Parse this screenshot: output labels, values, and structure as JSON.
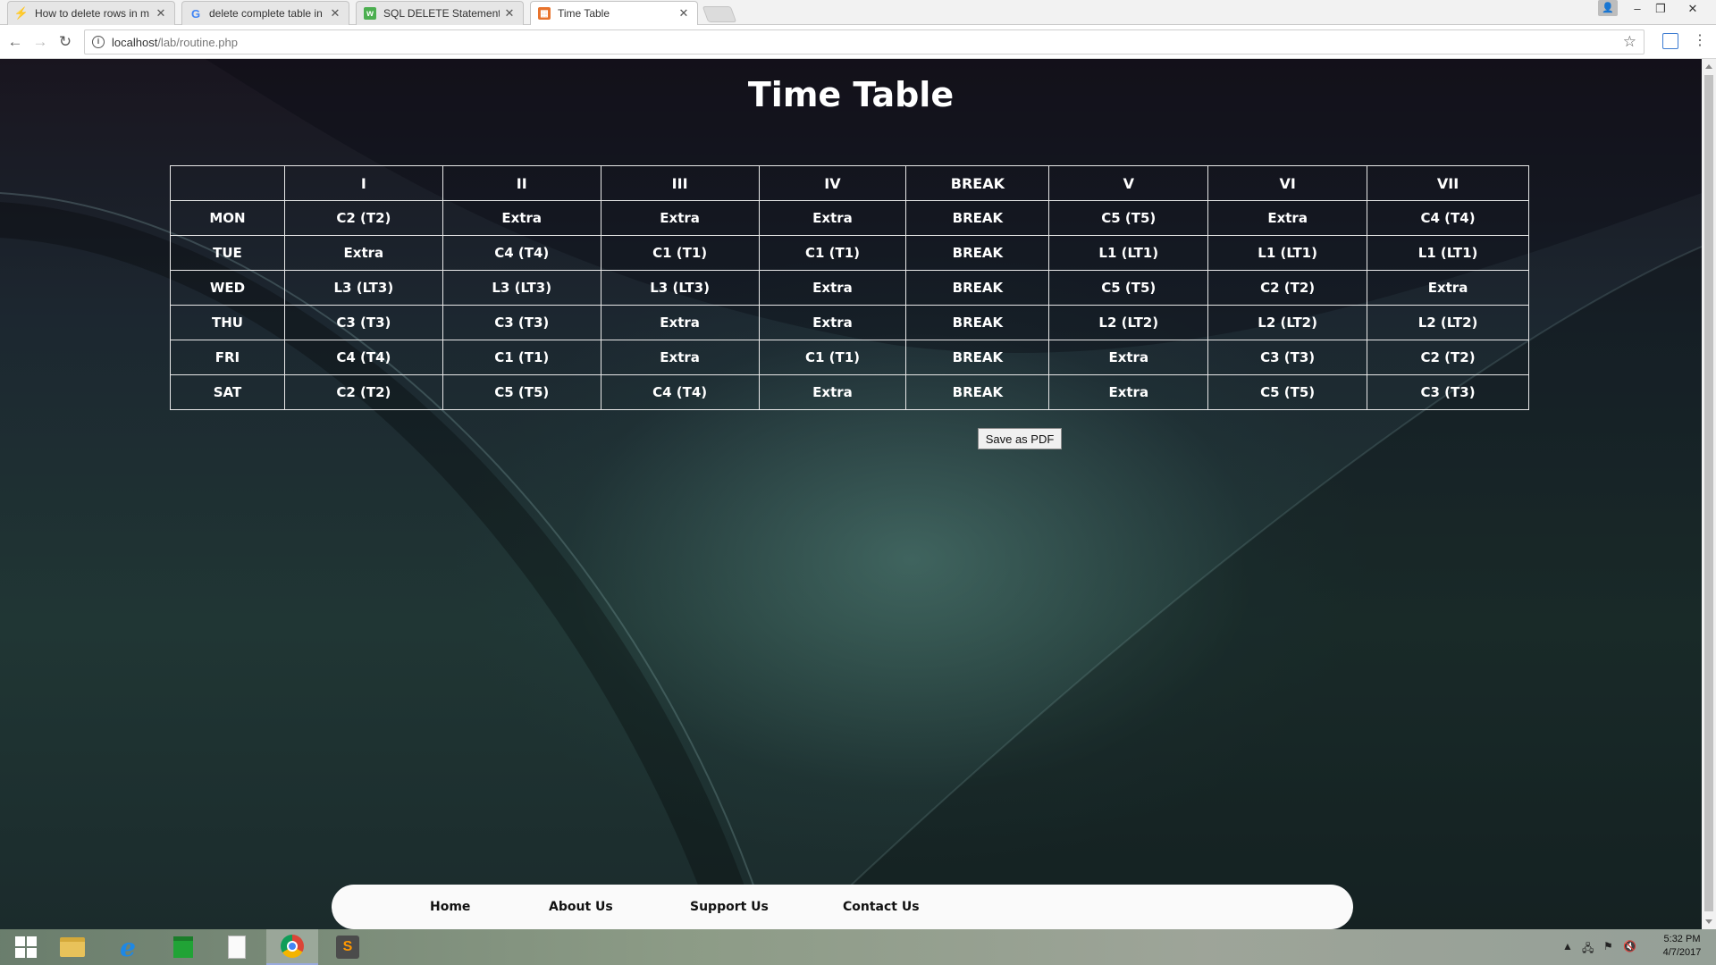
{
  "browser": {
    "tabs": [
      {
        "title": "How to delete rows in m",
        "favicon": "stackoverflow-icon",
        "color": "#f48024"
      },
      {
        "title": "delete complete table in",
        "favicon": "google-icon",
        "color": "#4285f4"
      },
      {
        "title": "SQL DELETE Statement",
        "favicon": "w3schools-icon",
        "color": "#4caf50"
      },
      {
        "title": "Time Table",
        "favicon": "page-icon",
        "color": "#e8732c"
      }
    ],
    "url_host": "localhost",
    "url_path": "/lab/routine.php"
  },
  "page": {
    "title": "Time Table",
    "table": {
      "headers": [
        "",
        "I",
        "II",
        "III",
        "IV",
        "BREAK",
        "V",
        "VI",
        "VII"
      ],
      "rows": [
        [
          "MON",
          "C2 (T2)",
          "Extra",
          "Extra",
          "Extra",
          "BREAK",
          "C5 (T5)",
          "Extra",
          "C4 (T4)"
        ],
        [
          "TUE",
          "Extra",
          "C4 (T4)",
          "C1 (T1)",
          "C1 (T1)",
          "BREAK",
          "L1 (LT1)",
          "L1 (LT1)",
          "L1 (LT1)"
        ],
        [
          "WED",
          "L3 (LT3)",
          "L3 (LT3)",
          "L3 (LT3)",
          "Extra",
          "BREAK",
          "C5 (T5)",
          "C2 (T2)",
          "Extra"
        ],
        [
          "THU",
          "C3 (T3)",
          "C3 (T3)",
          "Extra",
          "Extra",
          "BREAK",
          "L2 (LT2)",
          "L2 (LT2)",
          "L2 (LT2)"
        ],
        [
          "FRI",
          "C4 (T4)",
          "C1 (T1)",
          "Extra",
          "C1 (T1)",
          "BREAK",
          "Extra",
          "C3 (T3)",
          "C2 (T2)"
        ],
        [
          "SAT",
          "C2 (T2)",
          "C5 (T5)",
          "C4 (T4)",
          "Extra",
          "BREAK",
          "Extra",
          "C5 (T5)",
          "C3 (T3)"
        ]
      ]
    },
    "save_pdf_label": "Save as PDF",
    "footer_nav": [
      "Home",
      "About Us",
      "Support Us",
      "Contact Us"
    ]
  },
  "taskbar": {
    "apps": [
      "windows-start-icon",
      "file-explorer-icon",
      "internet-explorer-icon",
      "store-icon",
      "notepad-icon",
      "chrome-icon",
      "sublime-text-icon"
    ],
    "active_app": "chrome-icon",
    "time": "5:32 PM",
    "date": "4/7/2017"
  }
}
